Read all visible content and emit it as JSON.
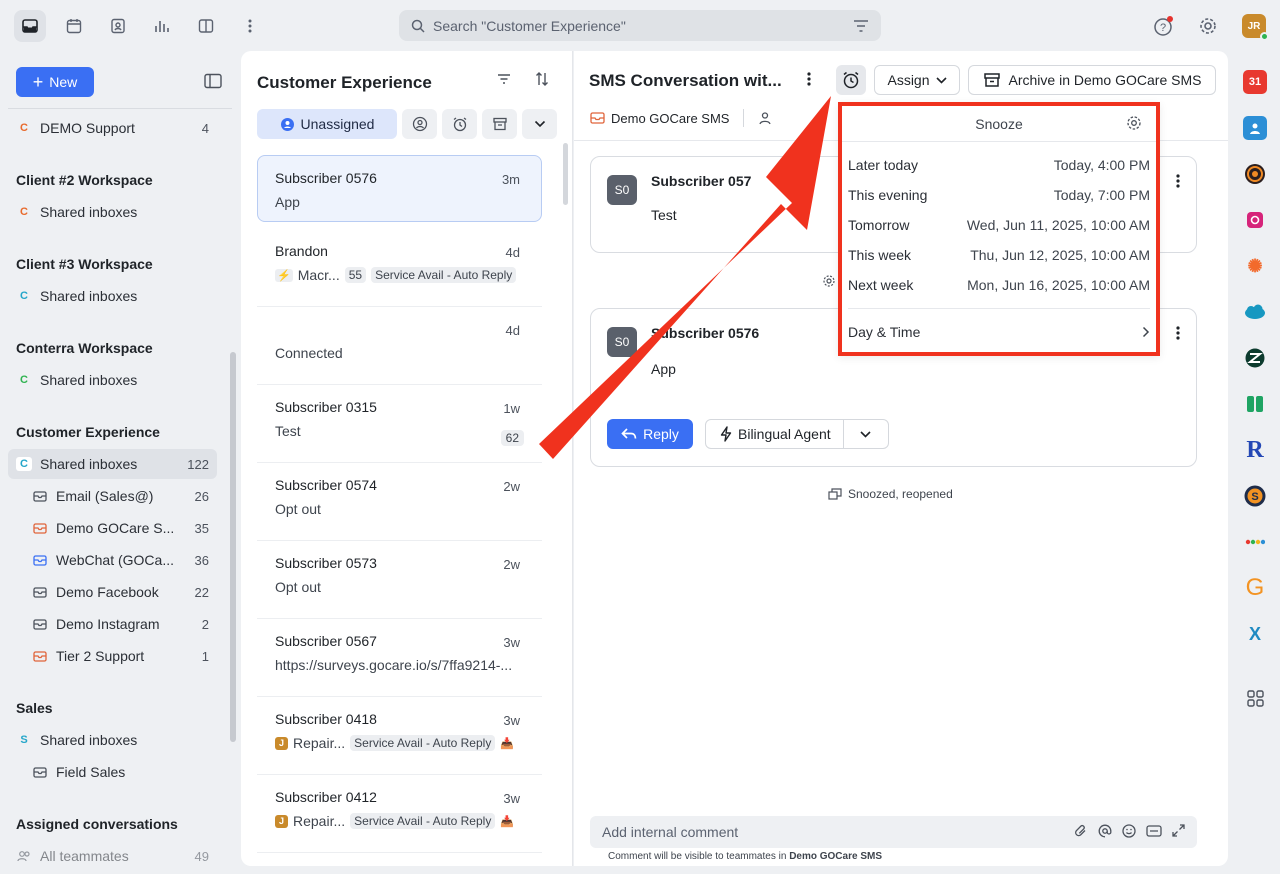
{
  "topbar": {
    "search_placeholder": "Search \"Customer Experience\"",
    "user_initials": "JR"
  },
  "sidebar": {
    "new_label": "New",
    "top_item": {
      "label": "DEMO Support",
      "count": "4",
      "badge": "C"
    },
    "sections": [
      {
        "title": "Client #2 Workspace",
        "item": {
          "label": "Shared inboxes",
          "badge": "C"
        }
      },
      {
        "title": "Client #3 Workspace",
        "item": {
          "label": "Shared inboxes",
          "badge": "C"
        }
      },
      {
        "title": "Conterra Workspace",
        "item": {
          "label": "Shared inboxes",
          "badge": "C"
        }
      },
      {
        "title": "Customer Experience",
        "item": {
          "label": "Shared inboxes",
          "badge": "C",
          "count": "122"
        }
      }
    ],
    "inboxes": [
      {
        "label": "Email (Sales@)",
        "count": "26"
      },
      {
        "label": "Demo GOCare S...",
        "count": "35"
      },
      {
        "label": "WebChat (GOCa...",
        "count": "36"
      },
      {
        "label": "Demo Facebook",
        "count": "22"
      },
      {
        "label": "Demo Instagram",
        "count": "2"
      },
      {
        "label": "Tier 2 Support",
        "count": "1"
      }
    ],
    "sales": {
      "title": "Sales",
      "shared": "Shared inboxes",
      "badge": "S",
      "field": "Field Sales"
    },
    "assigned": {
      "title": "Assigned conversations",
      "teammates": "All teammates",
      "count": "49"
    }
  },
  "list": {
    "title": "Customer Experience",
    "filter_active": "Unassigned",
    "conversations": [
      {
        "name": "Subscriber 0576",
        "time": "3m",
        "preview": "App"
      },
      {
        "name": "Brandon",
        "time": "4d",
        "preview": "Macr...",
        "count": "55",
        "tag": "Service Avail - Auto Reply"
      },
      {
        "name": "",
        "time": "4d",
        "preview": "Connected"
      },
      {
        "name": "Subscriber 0315",
        "time": "1w",
        "preview": "Test",
        "count": "62"
      },
      {
        "name": "Subscriber 0574",
        "time": "2w",
        "preview": "Opt out"
      },
      {
        "name": "Subscriber 0573",
        "time": "2w",
        "preview": "Opt out"
      },
      {
        "name": "Subscriber 0567",
        "time": "3w",
        "preview": "https://surveys.gocare.io/s/7ffa9214-..."
      },
      {
        "name": "Subscriber 0418",
        "time": "3w",
        "preview": "Repair...",
        "tag": "Service Avail - Auto Reply",
        "badge": "J"
      },
      {
        "name": "Subscriber 0412",
        "time": "3w",
        "preview": "Repair...",
        "tag": "Service Avail - Auto Reply",
        "badge": "J"
      }
    ]
  },
  "conversation": {
    "title": "SMS Conversation wit...",
    "assign_label": "Assign",
    "archive_label": "Archive in Demo GOCare SMS",
    "inbox_label": "Demo GOCare SMS",
    "messages": [
      {
        "avatar": "S0",
        "author": "Subscriber 057",
        "body": "Test"
      },
      {
        "avatar": "S0",
        "author": "Subscriber 0576",
        "body": "App"
      }
    ],
    "reply_label": "Reply",
    "agent_label": "Bilingual Agent",
    "event_label": "Snoozed, reopened",
    "comment_placeholder": "Add internal comment",
    "comment_note_prefix": "Comment will be visible to teammates in ",
    "comment_note_inbox": "Demo GOCare SMS"
  },
  "snooze": {
    "title": "Snooze",
    "options": [
      {
        "label": "Later today",
        "when": "Today, 4:00 PM"
      },
      {
        "label": "This evening",
        "when": "Today, 7:00 PM"
      },
      {
        "label": "Tomorrow",
        "when": "Wed, Jun 11, 2025, 10:00 AM"
      },
      {
        "label": "This week",
        "when": "Thu, Jun 12, 2025, 10:00 AM"
      },
      {
        "label": "Next week",
        "when": "Mon, Jun 16, 2025, 10:00 AM"
      }
    ],
    "custom_label": "Day & Time"
  },
  "rail": {
    "calendar_day": "31",
    "r_letter": "R",
    "g_letter": "G",
    "x_letter": "X"
  },
  "colors": {
    "accent": "#3a6ff3",
    "highlight": "#f0321e"
  }
}
